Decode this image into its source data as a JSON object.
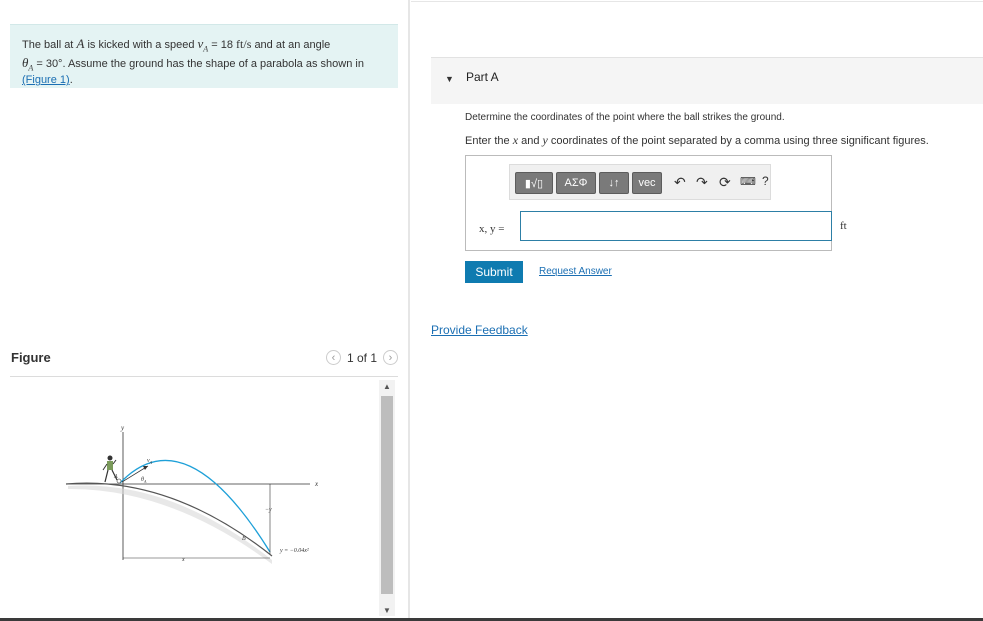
{
  "problem": {
    "text_line1_prefix": "The ball at",
    "point_A": "A",
    "text_line1_mid": "is kicked with a speed",
    "speed_symbol": "v",
    "speed_sub": "A",
    "speed_value": "= 18",
    "speed_unit": "ft/s",
    "text_line1_suffix": "and at an angle",
    "angle_symbol": "θ",
    "angle_sub": "A",
    "angle_value": "= 30°",
    "text_line2_suffix": ". Assume the ground has the shape of a parabola as shown in",
    "figure_link": "(Figure 1)",
    "figure_link_suffix": "."
  },
  "figure_panel": {
    "title": "Figure",
    "pager_text": "1 of 1",
    "prev_icon": "chevron-left-icon",
    "next_icon": "chevron-right-icon",
    "diagram_labels": {
      "y_axis": "y",
      "x_axis": "x",
      "v_label": "v",
      "v_sub": "A",
      "theta_label": "θ",
      "theta_sub": "A",
      "point_A": "A",
      "point_B": "B",
      "minus_y": "−y",
      "x_bottom": "x",
      "equation": "y = −0.04x²"
    }
  },
  "part": {
    "title": "Part A",
    "question": "Determine the coordinates of the point where the ball strikes the ground.",
    "instruction_prefix": "Enter the",
    "instruction_x": "x",
    "instruction_and": "and",
    "instruction_y": "y",
    "instruction_suffix": "coordinates of the point separated by a comma using three significant figures.",
    "toolbar": {
      "templates_label": "▮√▯",
      "greek_label": "ΑΣΦ",
      "arrows_label": "↓↑",
      "vec_label": "vec",
      "undo_icon": "undo-icon",
      "redo_icon": "redo-icon",
      "reset_icon": "reset-icon",
      "keyboard_icon": "keyboard-icon",
      "help_label": "?"
    },
    "answer_label": "x, y =",
    "answer_value": "",
    "unit": "ft",
    "submit_label": "Submit",
    "request_label": "Request Answer"
  },
  "feedback_label": "Provide Feedback",
  "colors": {
    "problem_bg": "#e4f3f3",
    "submit_bg": "#0f7bb0",
    "link": "#1b6fb3",
    "trajectory": "#1ea0d8"
  }
}
